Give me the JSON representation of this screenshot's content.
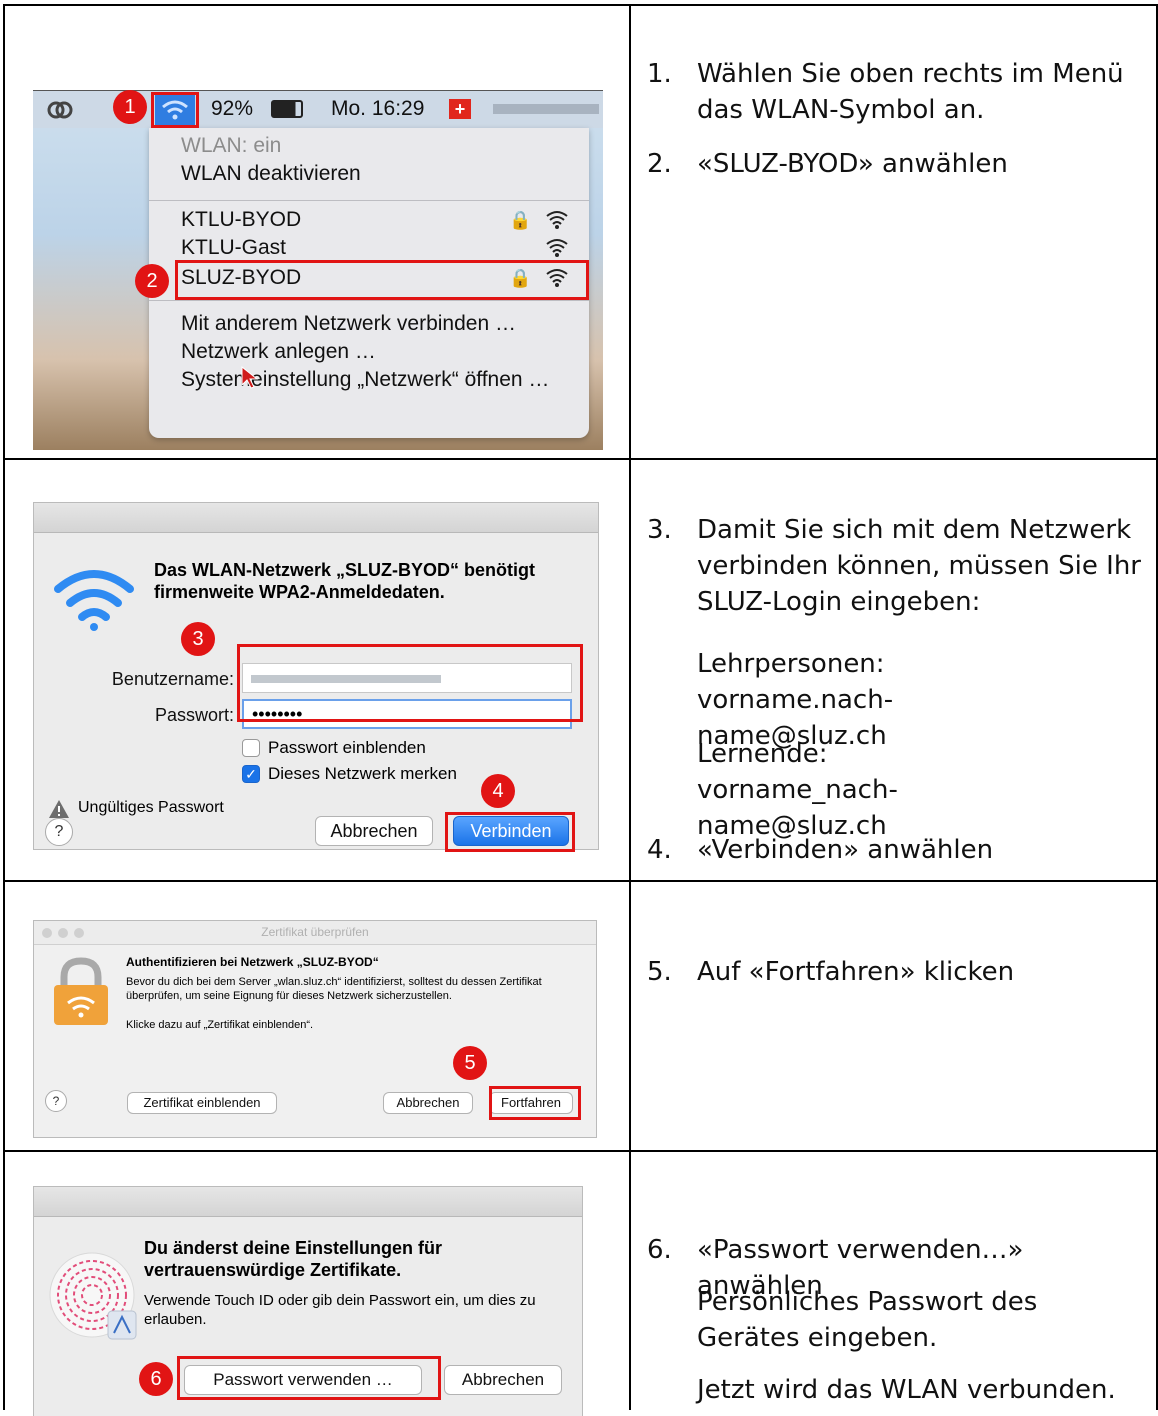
{
  "rows": [
    {
      "screenshot": {
        "menubar": {
          "battery": "92%",
          "time": "Mo. 16:29"
        },
        "menu": {
          "status": "WLAN: ein",
          "items": [
            "WLAN deaktivieren",
            "KTLU-BYOD",
            "KTLU-Gast",
            "SLUZ-BYOD",
            "Mit anderem Netzwerk verbinden …",
            "Netzwerk anlegen …",
            "Systemeinstellung „Netzwerk“ öffnen …"
          ]
        },
        "markers": [
          "1",
          "2"
        ]
      },
      "instructions": [
        {
          "num": "1.",
          "text": "Wählen Sie oben rechts im Menü das WLAN-Symbol an."
        },
        {
          "num": "2.",
          "text": "«SLUZ-BYOD» anwählen"
        }
      ]
    },
    {
      "screenshot": {
        "heading": "Das WLAN-Netzwerk „SLUZ-BYOD“ benötigt firmenweite WPA2-Anmeldedaten.",
        "username_label": "Benutzername:",
        "password_label": "Passwort:",
        "password_value": "••••••••",
        "show_password": "Passwort einblenden",
        "remember": "Dieses Netzwerk merken",
        "warning": "Ungültiges Passwort",
        "cancel": "Abbrechen",
        "connect": "Verbinden",
        "help": "?",
        "markers": [
          "3",
          "4"
        ]
      },
      "instructions": [
        {
          "num": "3.",
          "text": "Damit Sie sich mit dem Netzwerk verbinden können, müssen Sie Ihr SLUZ-Login eingeben:"
        },
        {
          "text": "Lehrpersonen: vorname.nach-name@sluz.ch"
        },
        {
          "text": "Lernende: vorname_nach-name@sluz.ch"
        },
        {
          "num": "4.",
          "text": "«Verbinden» anwählen"
        }
      ]
    },
    {
      "screenshot": {
        "window_title": "Zertifikat überprüfen",
        "heading": "Authentifizieren bei Netzwerk „SLUZ-BYOD“",
        "body": "Bevor du dich bei dem Server „wlan.sluz.ch“ identifizierst, solltest du dessen Zertifikat überprüfen, um seine Eignung für dieses Netzwerk sicherzustellen.",
        "hint": "Klicke dazu auf „Zertifikat einblenden“.",
        "show_cert": "Zertifikat einblenden",
        "cancel": "Abbrechen",
        "continue": "Fortfahren",
        "help": "?",
        "markers": [
          "5"
        ]
      },
      "instructions": [
        {
          "num": "5.",
          "text": "Auf «Fortfahren» klicken"
        }
      ]
    },
    {
      "screenshot": {
        "heading": "Du änderst deine Einstellungen für vertrauenswürdige Zertifikate.",
        "body": "Verwende Touch ID oder gib dein Passwort ein, um dies zu erlauben.",
        "use_password": "Passwort verwenden …",
        "cancel": "Abbrechen",
        "markers": [
          "6"
        ]
      },
      "instructions": [
        {
          "num": "6.",
          "text": "«Passwort verwenden…» anwählen"
        },
        {
          "text": "Persönliches Passwort des Gerätes eingeben."
        },
        {
          "text": "Jetzt wird das WLAN verbunden."
        }
      ]
    }
  ]
}
